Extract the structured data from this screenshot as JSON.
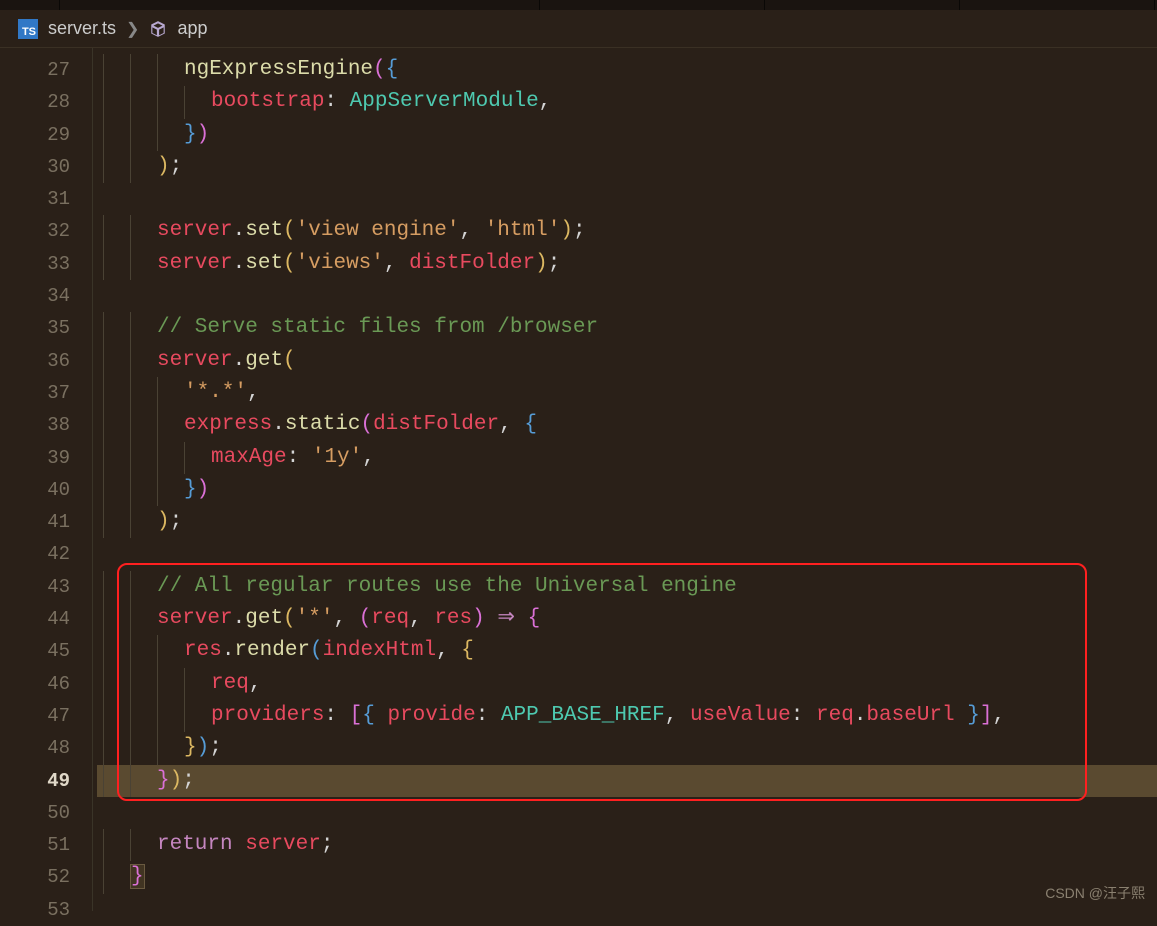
{
  "breadcrumb": {
    "file": "server.ts",
    "symbol": "app"
  },
  "tab_widths": [
    60,
    480,
    225,
    195,
    195
  ],
  "line_start": 27,
  "line_end": 53,
  "active_line": 49,
  "highlight_box": {
    "top_line": 43,
    "bottom_line": 49
  },
  "code": [
    {
      "n": 27,
      "indent": 3,
      "tokens": [
        {
          "t": "ngExpressEngine",
          "c": "tk-fn"
        },
        {
          "t": "(",
          "c": "tk-brace-p"
        },
        {
          "t": "{",
          "c": "tk-brace-b"
        }
      ]
    },
    {
      "n": 28,
      "indent": 4,
      "tokens": [
        {
          "t": "bootstrap",
          "c": "tk-prop"
        },
        {
          "t": ":",
          "c": "tk-punc"
        },
        {
          "t": " ",
          "c": ""
        },
        {
          "t": "AppServerModule",
          "c": "tk-type"
        },
        {
          "t": ",",
          "c": "tk-punc"
        }
      ]
    },
    {
      "n": 29,
      "indent": 3,
      "tokens": [
        {
          "t": "}",
          "c": "tk-brace-b"
        },
        {
          "t": ")",
          "c": "tk-brace-p"
        }
      ]
    },
    {
      "n": 30,
      "indent": 2,
      "tokens": [
        {
          "t": ")",
          "c": "tk-brace-y"
        },
        {
          "t": ";",
          "c": "tk-punc"
        }
      ]
    },
    {
      "n": 31,
      "indent": 0,
      "tokens": []
    },
    {
      "n": 32,
      "indent": 2,
      "tokens": [
        {
          "t": "server",
          "c": "tk-var"
        },
        {
          "t": ".",
          "c": "tk-punc"
        },
        {
          "t": "set",
          "c": "tk-method"
        },
        {
          "t": "(",
          "c": "tk-brace-y"
        },
        {
          "t": "'view engine'",
          "c": "tk-str"
        },
        {
          "t": ", ",
          "c": "tk-punc"
        },
        {
          "t": "'html'",
          "c": "tk-str"
        },
        {
          "t": ")",
          "c": "tk-brace-y"
        },
        {
          "t": ";",
          "c": "tk-punc"
        }
      ]
    },
    {
      "n": 33,
      "indent": 2,
      "tokens": [
        {
          "t": "server",
          "c": "tk-var"
        },
        {
          "t": ".",
          "c": "tk-punc"
        },
        {
          "t": "set",
          "c": "tk-method"
        },
        {
          "t": "(",
          "c": "tk-brace-y"
        },
        {
          "t": "'views'",
          "c": "tk-str"
        },
        {
          "t": ", ",
          "c": "tk-punc"
        },
        {
          "t": "distFolder",
          "c": "tk-var"
        },
        {
          "t": ")",
          "c": "tk-brace-y"
        },
        {
          "t": ";",
          "c": "tk-punc"
        }
      ]
    },
    {
      "n": 34,
      "indent": 0,
      "tokens": []
    },
    {
      "n": 35,
      "indent": 2,
      "tokens": [
        {
          "t": "// Serve static files from /browser",
          "c": "tk-comment"
        }
      ]
    },
    {
      "n": 36,
      "indent": 2,
      "tokens": [
        {
          "t": "server",
          "c": "tk-var"
        },
        {
          "t": ".",
          "c": "tk-punc"
        },
        {
          "t": "get",
          "c": "tk-method"
        },
        {
          "t": "(",
          "c": "tk-brace-y"
        }
      ]
    },
    {
      "n": 37,
      "indent": 3,
      "tokens": [
        {
          "t": "'*.*'",
          "c": "tk-str"
        },
        {
          "t": ",",
          "c": "tk-punc"
        }
      ]
    },
    {
      "n": 38,
      "indent": 3,
      "tokens": [
        {
          "t": "express",
          "c": "tk-var"
        },
        {
          "t": ".",
          "c": "tk-punc"
        },
        {
          "t": "static",
          "c": "tk-method"
        },
        {
          "t": "(",
          "c": "tk-brace-p"
        },
        {
          "t": "distFolder",
          "c": "tk-var"
        },
        {
          "t": ", ",
          "c": "tk-punc"
        },
        {
          "t": "{",
          "c": "tk-brace-b"
        }
      ]
    },
    {
      "n": 39,
      "indent": 4,
      "tokens": [
        {
          "t": "maxAge",
          "c": "tk-prop"
        },
        {
          "t": ":",
          "c": "tk-punc"
        },
        {
          "t": " ",
          "c": ""
        },
        {
          "t": "'1y'",
          "c": "tk-str"
        },
        {
          "t": ",",
          "c": "tk-punc"
        }
      ]
    },
    {
      "n": 40,
      "indent": 3,
      "tokens": [
        {
          "t": "}",
          "c": "tk-brace-b"
        },
        {
          "t": ")",
          "c": "tk-brace-p"
        }
      ]
    },
    {
      "n": 41,
      "indent": 2,
      "tokens": [
        {
          "t": ")",
          "c": "tk-brace-y"
        },
        {
          "t": ";",
          "c": "tk-punc"
        }
      ]
    },
    {
      "n": 42,
      "indent": 0,
      "tokens": []
    },
    {
      "n": 43,
      "indent": 2,
      "tokens": [
        {
          "t": "// All regular routes use the Universal engine",
          "c": "tk-comment"
        }
      ]
    },
    {
      "n": 44,
      "indent": 2,
      "tokens": [
        {
          "t": "server",
          "c": "tk-var"
        },
        {
          "t": ".",
          "c": "tk-punc"
        },
        {
          "t": "get",
          "c": "tk-method"
        },
        {
          "t": "(",
          "c": "tk-brace-y"
        },
        {
          "t": "'*'",
          "c": "tk-str"
        },
        {
          "t": ", ",
          "c": "tk-punc"
        },
        {
          "t": "(",
          "c": "tk-brace-p"
        },
        {
          "t": "req",
          "c": "tk-param"
        },
        {
          "t": ", ",
          "c": "tk-punc"
        },
        {
          "t": "res",
          "c": "tk-param"
        },
        {
          "t": ")",
          "c": "tk-brace-p"
        },
        {
          "t": " ",
          "c": ""
        },
        {
          "t": "⇒",
          "c": "tk-kw"
        },
        {
          "t": " ",
          "c": ""
        },
        {
          "t": "{",
          "c": "tk-brace-p"
        }
      ]
    },
    {
      "n": 45,
      "indent": 3,
      "tokens": [
        {
          "t": "res",
          "c": "tk-var"
        },
        {
          "t": ".",
          "c": "tk-punc"
        },
        {
          "t": "render",
          "c": "tk-method"
        },
        {
          "t": "(",
          "c": "tk-brace-b"
        },
        {
          "t": "indexHtml",
          "c": "tk-var"
        },
        {
          "t": ", ",
          "c": "tk-punc"
        },
        {
          "t": "{",
          "c": "tk-brace-y"
        }
      ]
    },
    {
      "n": 46,
      "indent": 4,
      "tokens": [
        {
          "t": "req",
          "c": "tk-prop"
        },
        {
          "t": ",",
          "c": "tk-punc"
        }
      ]
    },
    {
      "n": 47,
      "indent": 4,
      "tokens": [
        {
          "t": "providers",
          "c": "tk-prop"
        },
        {
          "t": ":",
          "c": "tk-punc"
        },
        {
          "t": " ",
          "c": ""
        },
        {
          "t": "[",
          "c": "tk-brace-p"
        },
        {
          "t": "{",
          "c": "tk-brace-b"
        },
        {
          "t": " ",
          "c": ""
        },
        {
          "t": "provide",
          "c": "tk-prop"
        },
        {
          "t": ":",
          "c": "tk-punc"
        },
        {
          "t": " ",
          "c": ""
        },
        {
          "t": "APP_BASE_HREF",
          "c": "tk-type"
        },
        {
          "t": ", ",
          "c": "tk-punc"
        },
        {
          "t": "useValue",
          "c": "tk-prop"
        },
        {
          "t": ":",
          "c": "tk-punc"
        },
        {
          "t": " ",
          "c": ""
        },
        {
          "t": "req",
          "c": "tk-var"
        },
        {
          "t": ".",
          "c": "tk-punc"
        },
        {
          "t": "baseUrl",
          "c": "tk-var"
        },
        {
          "t": " ",
          "c": ""
        },
        {
          "t": "}",
          "c": "tk-brace-b"
        },
        {
          "t": "]",
          "c": "tk-brace-p"
        },
        {
          "t": ",",
          "c": "tk-punc"
        }
      ]
    },
    {
      "n": 48,
      "indent": 3,
      "tokens": [
        {
          "t": "}",
          "c": "tk-brace-y"
        },
        {
          "t": ")",
          "c": "tk-brace-b"
        },
        {
          "t": ";",
          "c": "tk-punc"
        }
      ]
    },
    {
      "n": 49,
      "indent": 2,
      "hl": true,
      "tokens": [
        {
          "t": "}",
          "c": "tk-brace-p"
        },
        {
          "t": ")",
          "c": "tk-brace-y"
        },
        {
          "t": ";",
          "c": "tk-punc"
        }
      ]
    },
    {
      "n": 50,
      "indent": 0,
      "tokens": []
    },
    {
      "n": 51,
      "indent": 2,
      "tokens": [
        {
          "t": "return",
          "c": "tk-kw"
        },
        {
          "t": " ",
          "c": ""
        },
        {
          "t": "server",
          "c": "tk-var"
        },
        {
          "t": ";",
          "c": "tk-punc"
        }
      ]
    },
    {
      "n": 52,
      "indent": 1,
      "tokens": [
        {
          "t": "}",
          "c": "tk-brace-p bracket-match"
        }
      ]
    },
    {
      "n": 53,
      "indent": 0,
      "tokens": []
    }
  ],
  "watermark": "CSDN @汪子熙"
}
